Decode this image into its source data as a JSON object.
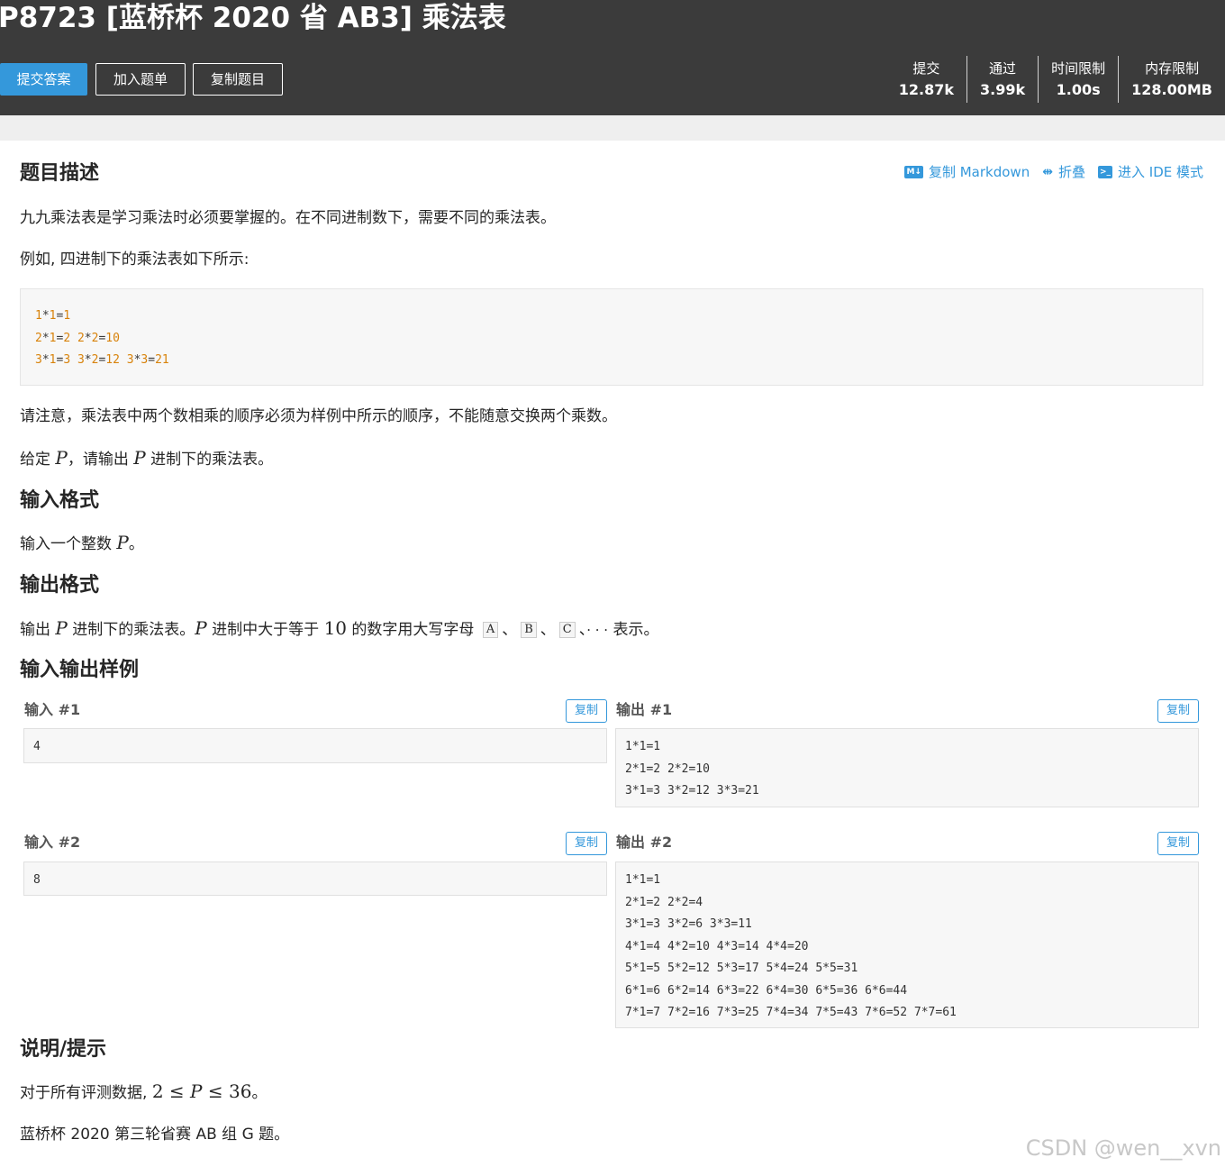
{
  "header": {
    "title": "P8723 [蓝桥杯 2020 省 AB3] 乘法表",
    "buttons": {
      "submit": "提交答案",
      "add": "加入题单",
      "copy": "复制题目"
    },
    "stats": [
      {
        "label": "提交",
        "value": "12.87k"
      },
      {
        "label": "通过",
        "value": "3.99k"
      },
      {
        "label": "时间限制",
        "value": "1.00s"
      },
      {
        "label": "内存限制",
        "value": "128.00MB"
      }
    ]
  },
  "toolbar": {
    "copy_md": "复制 Markdown",
    "fold": "折叠",
    "ide": "进入 IDE 模式",
    "md_icon": "M↓"
  },
  "description": {
    "heading": "题目描述",
    "p1": "九九乘法表是学习乘法时必须要掌握的。在不同进制数下，需要不同的乘法表。",
    "p2": "例如, 四进制下的乘法表如下所示:",
    "code": [
      [
        [
          "1",
          "n"
        ],
        [
          "*",
          "o"
        ],
        [
          "1",
          "n"
        ],
        [
          "=",
          "o"
        ],
        [
          "1",
          "n"
        ]
      ],
      [
        [
          "2",
          "n"
        ],
        [
          "*",
          "o"
        ],
        [
          "1",
          "n"
        ],
        [
          "=",
          "o"
        ],
        [
          "2",
          "n"
        ],
        [
          " ",
          "o"
        ],
        [
          "2",
          "n"
        ],
        [
          "*",
          "o"
        ],
        [
          "2",
          "n"
        ],
        [
          "=",
          "o"
        ],
        [
          "10",
          "n"
        ]
      ],
      [
        [
          "3",
          "n"
        ],
        [
          "*",
          "o"
        ],
        [
          "1",
          "n"
        ],
        [
          "=",
          "o"
        ],
        [
          "3",
          "n"
        ],
        [
          " ",
          "o"
        ],
        [
          "3",
          "n"
        ],
        [
          "*",
          "o"
        ],
        [
          "2",
          "n"
        ],
        [
          "=",
          "o"
        ],
        [
          "12",
          "n"
        ],
        [
          " ",
          "o"
        ],
        [
          "3",
          "n"
        ],
        [
          "*",
          "o"
        ],
        [
          "3",
          "n"
        ],
        [
          "=",
          "o"
        ],
        [
          "21",
          "n"
        ]
      ]
    ],
    "p3": "请注意，乘法表中两个数相乘的顺序必须为样例中所示的顺序，不能随意交换两个乘数。",
    "p4_a": "给定 ",
    "p4_b": "，请输出 ",
    "p4_c": " 进制下的乘法表。",
    "var_p": "P"
  },
  "input_format": {
    "heading": "输入格式",
    "text_a": "输入一个整数 ",
    "text_b": "。"
  },
  "output_format": {
    "heading": "输出格式",
    "a": "输出 ",
    "b": " 进制下的乘法表。",
    "c": " 进制中大于等于 ",
    "ten": "10",
    "d": " 的数字用大写字母 ",
    "kA": "A",
    "kB": "B",
    "kC": "C",
    "sep": "、",
    "dots": "· · ·",
    "e": " 表示。"
  },
  "samples": {
    "heading": "输入输出样例",
    "copy_label": "复制",
    "in1_label": "输入 #1",
    "out1_label": "输出 #1",
    "in2_label": "输入 #2",
    "out2_label": "输出 #2",
    "in1": [
      "4"
    ],
    "out1": [
      "1*1=1",
      "2*1=2 2*2=10",
      "3*1=3 3*2=12 3*3=21"
    ],
    "in2": [
      "8"
    ],
    "out2": [
      "1*1=1",
      "2*1=2 2*2=4",
      "3*1=3 3*2=6 3*3=11",
      "4*1=4 4*2=10 4*3=14 4*4=20",
      "5*1=5 5*2=12 5*3=17 5*4=24 5*5=31",
      "6*1=6 6*2=14 6*3=22 6*4=30 6*5=36 6*6=44",
      "7*1=7 7*2=16 7*3=25 7*4=34 7*5=43 7*6=52 7*7=61"
    ]
  },
  "hint": {
    "heading": "说明/提示",
    "a": "对于所有评测数据, ",
    "two": "2",
    "le": " ≤ ",
    "thirtysix": "36",
    "b": "。",
    "source": "蓝桥杯 2020 第三轮省赛 AB 组 G 题。"
  },
  "watermark": "CSDN @wen__xvn"
}
